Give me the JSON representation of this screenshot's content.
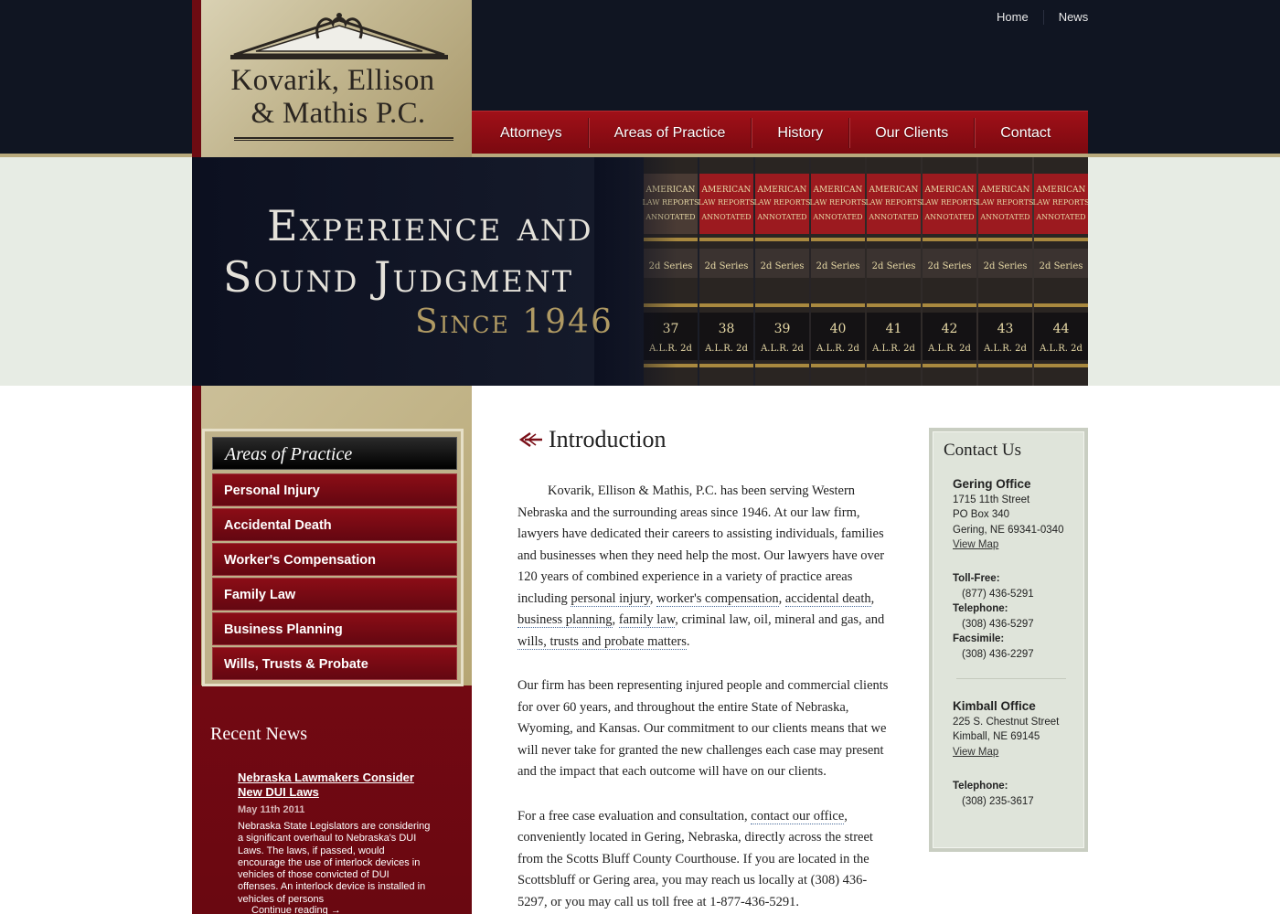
{
  "firm": {
    "name_line1": "Kovarik, Ellison",
    "name_line2": "& Mathis P.C."
  },
  "util_nav": [
    "Home",
    "News"
  ],
  "main_nav": [
    "Attorneys",
    "Areas of Practice",
    "History",
    "Our Clients",
    "Contact"
  ],
  "hero": {
    "line1": "Experience and",
    "line2": "Sound Judgment",
    "line3": "Since 1946"
  },
  "sidebar": {
    "aop_title": "Areas of Practice",
    "aop_items": [
      "Personal Injury",
      "Accidental Death",
      "Worker's Compensation",
      "Family Law",
      "Business Planning",
      "Wills, Trusts & Probate"
    ],
    "news_heading": "Recent News",
    "news_title": "Nebraska Lawmakers Consider New DUI Laws",
    "news_date": "May 11th 2011",
    "news_body": "Nebraska State Legislators are considering a significant overhaul to Nebraska's DUI Laws.  The laws, if passed, would encourage the use of interlock devices in vehicles of those convicted of DUI offenses.  An interlock device is installed in vehicles of persons",
    "news_more": "Continue reading →"
  },
  "content": {
    "title": "Introduction",
    "p1_a": "Kovarik, Ellison & Mathis, P.C. has been serving Western Nebraska and the surrounding areas since 1946. At our law firm, lawyers have dedicated their careers to assisting individuals, families and businesses when they need help the most. Our lawyers have over 120 years of combined experience in a variety of practice areas including ",
    "p1_links": [
      "personal injury",
      "worker's compensation",
      "accidental death",
      "business planning",
      "family law",
      "wills, trusts and probate matters"
    ],
    "p1_sep": ", ",
    "p1_mid": ", criminal law, oil, mineral and gas, and ",
    "p1_end": ".",
    "p2": "Our firm has been representing injured people and commercial clients for over 60 years, and throughout the entire State of Nebraska, Wyoming, and Kansas. Our commitment to our clients means that we will never take for granted the new challenges each case may present and the impact that each outcome will have on our clients.",
    "p3_a": "For a free case evaluation and consultation, ",
    "p3_link": "contact our office",
    "p3_b": ", conveniently located in Gering, Nebraska, directly across the street from the Scotts Bluff County Courthouse. If you are located in the Scottsbluff or Gering area, you may reach us locally at (308) 436-5297, or you may call us toll free at 1-877-436-5291."
  },
  "contact": {
    "title": "Contact Us",
    "gering": {
      "name": "Gering Office",
      "street": "1715 11th Street",
      "pobox": "PO Box 340",
      "city": "Gering, NE 69341-0340",
      "map": "View Map",
      "tollfree_label": "Toll-Free:",
      "tollfree": "(877) 436-5291",
      "phone_label": "Telephone:",
      "phone": "(308) 436-5297",
      "fax_label": "Facsimile:",
      "fax": "(308) 436-2297"
    },
    "kimball": {
      "name": "Kimball Office",
      "street": "225 S. Chestnut Street",
      "city": "Kimball, NE 69145",
      "map": "View Map",
      "phone_label": "Telephone:",
      "phone": "(308) 235-3617"
    }
  },
  "books": [
    {
      "vol": "37",
      "l1": "AMERICAN",
      "l2": "LAW REPORTS",
      "l3": "ANNOTATED",
      "series": "2d Series",
      "alr": "A.L.R. 2d"
    },
    {
      "vol": "38",
      "l1": "AMERICAN",
      "l2": "LAW REPORTS",
      "l3": "ANNOTATED",
      "series": "2d Series",
      "alr": "A.L.R. 2d"
    },
    {
      "vol": "39",
      "l1": "AMERICAN",
      "l2": "LAW REPORTS",
      "l3": "ANNOTATED",
      "series": "2d Series",
      "alr": "A.L.R. 2d"
    },
    {
      "vol": "40",
      "l1": "AMERICAN",
      "l2": "LAW REPORTS",
      "l3": "ANNOTATED",
      "series": "2d Series",
      "alr": "A.L.R. 2d"
    },
    {
      "vol": "41",
      "l1": "AMERICAN",
      "l2": "LAW REPORTS",
      "l3": "ANNOTATED",
      "series": "2d Series",
      "alr": "A.L.R. 2d"
    },
    {
      "vol": "42",
      "l1": "AMERICAN",
      "l2": "LAW REPORTS",
      "l3": "ANNOTATED",
      "series": "2d Series",
      "alr": "A.L.R. 2d"
    },
    {
      "vol": "43",
      "l1": "AMERICAN",
      "l2": "LAW REPORTS",
      "l3": "ANNOTATED",
      "series": "2d Series",
      "alr": "A.L.R. 2d"
    },
    {
      "vol": "44",
      "l1": "AMERICAN",
      "l2": "LAW REPORTS",
      "l3": "ANNOTATED",
      "series": "2d Series",
      "alr": "A.L.R. 2d"
    }
  ],
  "colors": {
    "header_dark": "#101522",
    "nav_red": "#8b0d16",
    "sidebar_red": "#6a0811",
    "gold": "#b09a63",
    "hero_band": "#e7ece4"
  }
}
